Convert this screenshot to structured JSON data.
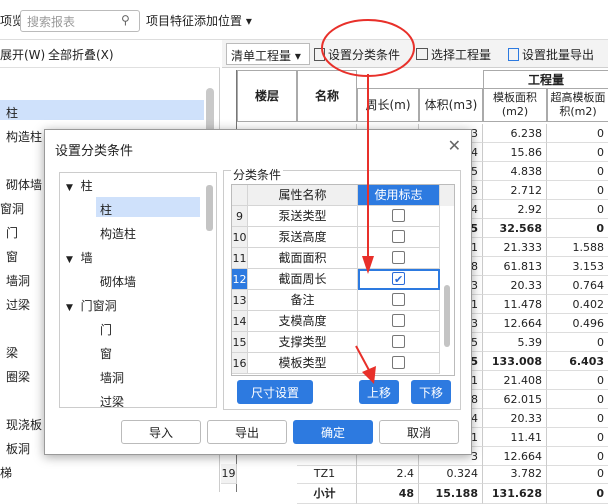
{
  "toolbar": {
    "left_cut": "项览",
    "search_placeholder": "搜索报表",
    "add_position": "项目特征添加位置 ▾"
  },
  "left_toolbar": {
    "expand": "展开(W)",
    "collapse_all": "全部折叠(X)"
  },
  "left_tree": [
    "柱",
    "构造柱",
    "砌体墙",
    "窗洞",
    "门",
    "窗",
    "墙洞",
    "过梁",
    "梁",
    "圈梁",
    "现浇板",
    "板洞",
    "梯"
  ],
  "right_toolbar": {
    "dropdown": "清单工程量 ▾",
    "set_condition": "设置分类条件",
    "select_qty": "选择工程量",
    "batch_export": "设置批量导出"
  },
  "grid": {
    "group_header": "工程量",
    "headers": [
      "楼层",
      "名称",
      "周长(m)",
      "体积(m3)",
      "模板面积(m2)",
      "超高模板面积(m2)"
    ],
    "rows": [
      {
        "perim": "",
        "vol": "3",
        "area": "6.238",
        "high": "0"
      },
      {
        "perim": "",
        "vol": "4",
        "area": "15.86",
        "high": "0"
      },
      {
        "perim": "",
        "vol": "5",
        "area": "4.838",
        "high": "0"
      },
      {
        "perim": "",
        "vol": "3",
        "area": "2.712",
        "high": "0"
      },
      {
        "perim": "",
        "vol": "4",
        "area": "2.92",
        "high": "0"
      },
      {
        "perim": "",
        "vol": "5",
        "area": "32.568",
        "high": "0"
      },
      {
        "perim": "",
        "vol": "1",
        "area": "21.333",
        "high": "1.588"
      },
      {
        "perim": "",
        "vol": "8",
        "area": "61.813",
        "high": "3.153"
      },
      {
        "perim": "",
        "vol": "3",
        "area": "20.33",
        "high": "0.764"
      },
      {
        "perim": "",
        "vol": "1",
        "area": "11.478",
        "high": "0.402"
      },
      {
        "perim": "",
        "vol": "3",
        "area": "12.664",
        "high": "0.496"
      },
      {
        "perim": "",
        "vol": "5",
        "area": "5.39",
        "high": "0"
      },
      {
        "perim": "",
        "vol": "5",
        "area": "133.008",
        "high": "6.403"
      },
      {
        "perim": "",
        "vol": "1",
        "area": "21.408",
        "high": "0"
      },
      {
        "perim": "",
        "vol": "8",
        "area": "62.015",
        "high": "0"
      },
      {
        "perim": "",
        "vol": "4",
        "area": "20.33",
        "high": "0"
      },
      {
        "perim": "",
        "vol": "1",
        "area": "11.41",
        "high": "0"
      },
      {
        "perim": "",
        "vol": "3",
        "area": "12.664",
        "high": "0"
      }
    ],
    "last_row": {
      "num": "19",
      "name": "TZ1",
      "perim": "2.4",
      "vol": "0.324",
      "area": "3.782",
      "high": "0"
    },
    "cut_row": {
      "name": "小计",
      "perim": "48",
      "vol": "15.188",
      "area": "131.628",
      "high": "0"
    }
  },
  "dialog": {
    "title": "设置分类条件",
    "tree": [
      {
        "label": "柱",
        "level": 0,
        "expanded": true
      },
      {
        "label": "柱",
        "level": 1,
        "selected": true
      },
      {
        "label": "构造柱",
        "level": 1
      },
      {
        "label": "墙",
        "level": 0,
        "expanded": true
      },
      {
        "label": "砌体墙",
        "level": 1
      },
      {
        "label": "门窗洞",
        "level": 0,
        "expanded": true
      },
      {
        "label": "门",
        "level": 1
      },
      {
        "label": "窗",
        "level": 1
      },
      {
        "label": "墙洞",
        "level": 1
      },
      {
        "label": "过梁",
        "level": 1
      }
    ],
    "group_label": "分类条件",
    "col_name": "属性名称",
    "col_flag": "使用标志",
    "rows": [
      {
        "num": "9",
        "name": "泵送类型",
        "checked": false
      },
      {
        "num": "10",
        "name": "泵送高度",
        "checked": false
      },
      {
        "num": "11",
        "name": "截面面积",
        "checked": false
      },
      {
        "num": "12",
        "name": "截面周长",
        "checked": true
      },
      {
        "num": "13",
        "name": "备注",
        "checked": false
      },
      {
        "num": "14",
        "name": "支模高度",
        "checked": false
      },
      {
        "num": "15",
        "name": "支撑类型",
        "checked": false
      },
      {
        "num": "16",
        "name": "模板类型",
        "checked": false
      }
    ],
    "btn_size": "尺寸设置",
    "btn_up": "上移",
    "btn_down": "下移",
    "btn_import": "导入",
    "btn_export": "导出",
    "btn_ok": "确定",
    "btn_cancel": "取消"
  },
  "colors": {
    "accent": "#2d7ae0",
    "annotation": "#e8302a",
    "selected_row": "#cfe1fb"
  }
}
